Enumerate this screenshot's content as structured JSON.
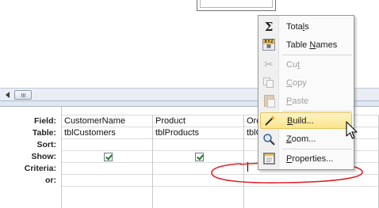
{
  "grid": {
    "row_labels": [
      "Field:",
      "Table:",
      "Sort:",
      "Show:",
      "Criteria:",
      "or:"
    ],
    "columns": [
      {
        "field": "CustomerName",
        "table": "tblCustomers",
        "sort": "",
        "show": true,
        "criteria": ""
      },
      {
        "field": "Product",
        "table": "tblProducts",
        "sort": "",
        "show": true,
        "criteria": ""
      },
      {
        "field": "Ord",
        "table": "tblO",
        "sort": "",
        "show": true,
        "criteria": ""
      }
    ]
  },
  "context_menu": {
    "items": [
      {
        "pre": "Tota",
        "hot": "l",
        "post": "s",
        "icon": "sigma-icon",
        "enabled": true
      },
      {
        "pre": "Table ",
        "hot": "N",
        "post": "ames",
        "icon": "table-names-icon",
        "enabled": true
      },
      {
        "pre": "Cu",
        "hot": "t",
        "post": "",
        "icon": "scissors-icon",
        "enabled": false
      },
      {
        "pre": "",
        "hot": "C",
        "post": "opy",
        "icon": "copy-icon",
        "enabled": false
      },
      {
        "pre": "",
        "hot": "P",
        "post": "aste",
        "icon": "paste-icon",
        "enabled": false
      },
      {
        "pre": "",
        "hot": "B",
        "post": "uild...",
        "icon": "build-wand-icon",
        "enabled": true,
        "hover": true
      },
      {
        "pre": "",
        "hot": "Z",
        "post": "oom...",
        "icon": "magnifier-icon",
        "enabled": true
      },
      {
        "pre": "",
        "hot": "P",
        "post": "roperties...",
        "icon": "properties-icon",
        "enabled": true
      }
    ]
  },
  "colors": {
    "annotation_red": "#d9262b",
    "menu_hover": "#fbe48a",
    "checkmark": "#1d7a2a"
  }
}
